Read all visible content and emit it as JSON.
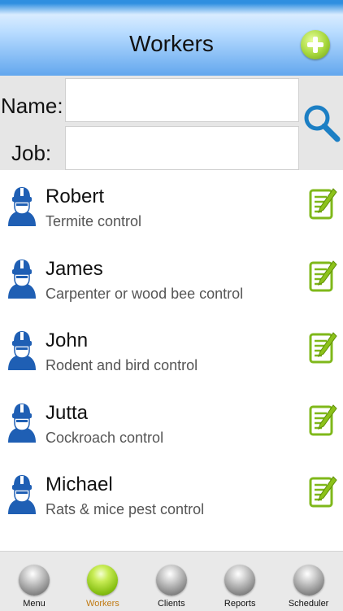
{
  "header": {
    "title": "Workers"
  },
  "search": {
    "name_label": "Name:",
    "job_label": "Job:",
    "name_value": "",
    "job_value": ""
  },
  "workers": [
    {
      "name": "Robert",
      "job": "Termite control"
    },
    {
      "name": "James",
      "job": "Carpenter or wood bee control"
    },
    {
      "name": "John",
      "job": "Rodent and bird control"
    },
    {
      "name": "Jutta",
      "job": "Cockroach control"
    },
    {
      "name": "Michael",
      "job": "Rats & mice pest control"
    }
  ],
  "nav": [
    {
      "label": "Menu",
      "active": false
    },
    {
      "label": "Workers",
      "active": true
    },
    {
      "label": "Clients",
      "active": false
    },
    {
      "label": "Reports",
      "active": false
    },
    {
      "label": "Scheduler",
      "active": false
    }
  ],
  "colors": {
    "header_blue": "#64a8ee",
    "accent_green": "#8cc21a",
    "worker_icon_blue": "#1f5fb4",
    "active_nav_label": "#c07a12"
  },
  "icons": {
    "add": "plus-circle-icon",
    "search": "magnifier-icon",
    "worker": "hardhat-worker-icon",
    "edit": "edit-note-icon"
  }
}
